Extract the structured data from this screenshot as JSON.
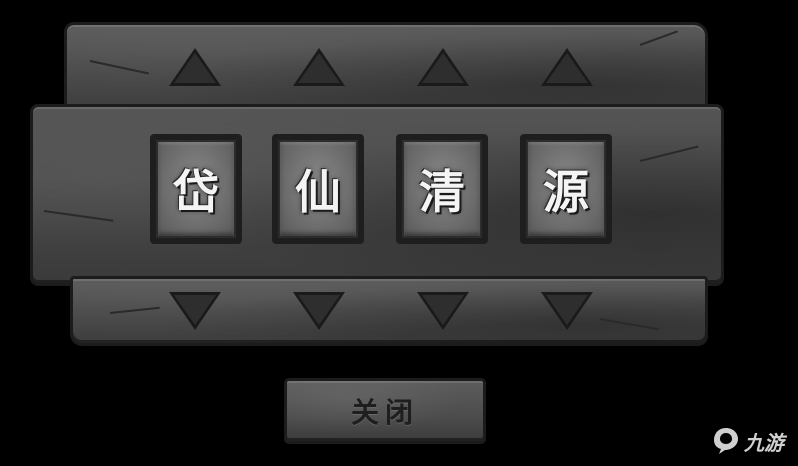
{
  "puzzle": {
    "characters": [
      "岱",
      "仙",
      "清",
      "源"
    ]
  },
  "close_button": {
    "label": "关闭"
  },
  "watermark": {
    "text": "九游",
    "icon": "jiuyou-logo-icon"
  },
  "colors": {
    "background": "#000000",
    "stone": "#4a4a4a",
    "tile_face": "#6f6f6f",
    "character": "#f4f4f4",
    "arrow_fill": "#2a2a2a"
  }
}
